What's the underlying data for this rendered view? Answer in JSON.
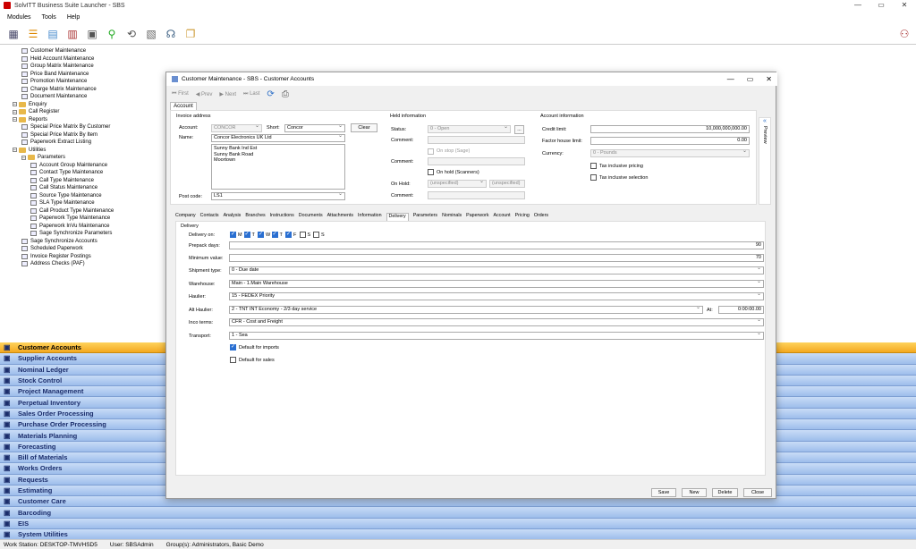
{
  "app": {
    "title": "SolvITT Business Suite Launcher - SBS"
  },
  "menu": [
    "Modules",
    "Tools",
    "Help"
  ],
  "window_controls": [
    "—",
    "▭",
    "✕"
  ],
  "tree": [
    {
      "label": "Customer Maintenance",
      "level": 1
    },
    {
      "label": "Held Account Maintenance",
      "level": 1
    },
    {
      "label": "Group Matrix Maintenance",
      "level": 1
    },
    {
      "label": "Price Band Maintenance",
      "level": 1
    },
    {
      "label": "Promotion Maintenance",
      "level": 1
    },
    {
      "label": "Charge Matrix Maintenance",
      "level": 1
    },
    {
      "label": "Document Maintenance",
      "level": 1
    },
    {
      "label": "Enquiry",
      "level": 0,
      "folder": true
    },
    {
      "label": "Call Register",
      "level": 0,
      "folder": true
    },
    {
      "label": "Reports",
      "level": 0,
      "folder": true
    },
    {
      "label": "Special Price Matrix By Customer",
      "level": 1
    },
    {
      "label": "Special Price Matrix By Item",
      "level": 1
    },
    {
      "label": "Paperwork Extract Listing",
      "level": 1
    },
    {
      "label": "Utilities",
      "level": 0,
      "folder": true
    },
    {
      "label": "Parameters",
      "level": 1,
      "folder": true
    },
    {
      "label": "Account Group Maintenance",
      "level": 2
    },
    {
      "label": "Contact Type Maintenance",
      "level": 2
    },
    {
      "label": "Call Type Maintenance",
      "level": 2
    },
    {
      "label": "Call Status Maintenance",
      "level": 2
    },
    {
      "label": "Source Type Maintenance",
      "level": 2
    },
    {
      "label": "SLA Type Maintenance",
      "level": 2
    },
    {
      "label": "Call Product Type Maintenance",
      "level": 2
    },
    {
      "label": "Paperwork Type Maintenance",
      "level": 2
    },
    {
      "label": "Paperwork InVu Maintenance",
      "level": 2
    },
    {
      "label": "Sage Synchronize Parameters",
      "level": 2
    },
    {
      "label": "Sage Synchronize Accounts",
      "level": 1
    },
    {
      "label": "Scheduled Paperwork",
      "level": 1
    },
    {
      "label": "Invoice Register Postings",
      "level": 1
    },
    {
      "label": "Address Checks (PAF)",
      "level": 1
    }
  ],
  "nav": [
    {
      "label": "Customer Accounts",
      "active": true
    },
    {
      "label": "Supplier Accounts"
    },
    {
      "label": "Nominal Ledger"
    },
    {
      "label": "Stock Control"
    },
    {
      "label": "Project Management"
    },
    {
      "label": "Perpetual Inventory"
    },
    {
      "label": "Sales Order Processing"
    },
    {
      "label": "Purchase Order Processing"
    },
    {
      "label": "Materials Planning"
    },
    {
      "label": "Forecasting"
    },
    {
      "label": "Bill of Materials"
    },
    {
      "label": "Works Orders"
    },
    {
      "label": "Requests"
    },
    {
      "label": "Estimating"
    },
    {
      "label": "Customer Care"
    },
    {
      "label": "Barcoding"
    },
    {
      "label": "EIS"
    },
    {
      "label": "System Utilities"
    }
  ],
  "status": {
    "workstation": "Work Station: DESKTOP-TMVHSD5",
    "user": "User: SBSAdmin",
    "groups": "Group(s): Administrators, Basic Demo"
  },
  "dialog": {
    "title": "Customer Maintenance - SBS - Customer Accounts",
    "nav": {
      "first": "First",
      "prev": "Prev",
      "next": "Next",
      "last": "Last"
    },
    "account_tab": "Account",
    "invoice": {
      "section": "Invoice address",
      "account_label": "Account:",
      "account_value": "CONCOR",
      "short_label": "Short:",
      "short_value": "Concor",
      "clear": "Clear",
      "name_label": "Name:",
      "name_value": "Concor Electronics UK Ltd",
      "address": [
        "Sunny Bank Ind Est",
        "Sunny Bank Road",
        "Moortown"
      ],
      "postcode_label": "Post code:",
      "postcode_value": "LS1"
    },
    "held": {
      "section": "Held information",
      "status_label": "Status:",
      "status_value": "0 - Open",
      "comment_label": "Comment:",
      "onstop": "On stop (Sage)",
      "onhold_scanners": "On hold (Scanners)",
      "onhold_label": "On Hold:",
      "onhold_a": "(unspecified)",
      "onhold_b": "(unspecified)",
      "dots": "..."
    },
    "acct": {
      "section": "Account information",
      "credit_label": "Credit limit:",
      "credit_value": "10,000,000,000.00",
      "factor_label": "Factor house limit:",
      "factor_value": "0.00",
      "currency_label": "Currency:",
      "currency_value": "0 - Pounds",
      "tax_incl_pricing": "Tax inclusive pricing",
      "tax_incl_selection": "Tax inclusive selection"
    },
    "preview": "Preview",
    "subtabs": [
      "Company",
      "Contacts",
      "Analysis",
      "Branches",
      "Instructions",
      "Documents",
      "Attachments",
      "Information",
      "Delivery",
      "Parameters",
      "Nominals",
      "Paperwork",
      "Account",
      "Pricing",
      "Orders"
    ],
    "active_subtab": "Delivery",
    "delivery": {
      "section": "Delivery",
      "on_label": "Delivery on:",
      "days": [
        {
          "d": "M",
          "on": true
        },
        {
          "d": "T",
          "on": true
        },
        {
          "d": "W",
          "on": true
        },
        {
          "d": "T",
          "on": true
        },
        {
          "d": "F",
          "on": true
        },
        {
          "d": "S",
          "on": false
        },
        {
          "d": "S",
          "on": false
        }
      ],
      "prepack_label": "Prepack days:",
      "prepack_value": "90",
      "minval_label": "Minimum value:",
      "minval_value": "70",
      "shiptype_label": "Shipment type:",
      "shiptype_value": "0 - Due date",
      "warehouse_label": "Warehouse:",
      "warehouse_value": "Main - 1.Main Warehouse",
      "haulier_label": "Haulier:",
      "haulier_value": "15 - FEDEX Priority",
      "alt_label": "Alt Haulier:",
      "alt_value": "2 - TNT INT Economy -  2/3 day service",
      "at_label": "At:",
      "at_value": "0:00:00.00",
      "inco_label": "Inco terms:",
      "inco_value": "CFR - Cost and Freight",
      "transport_label": "Transport:",
      "transport_value": "1 - Sea",
      "default_imports": "Default for imports",
      "default_sales": "Default for sales"
    },
    "buttons": {
      "save": "Save",
      "new": "New",
      "delete": "Delete",
      "close": "Close"
    }
  }
}
